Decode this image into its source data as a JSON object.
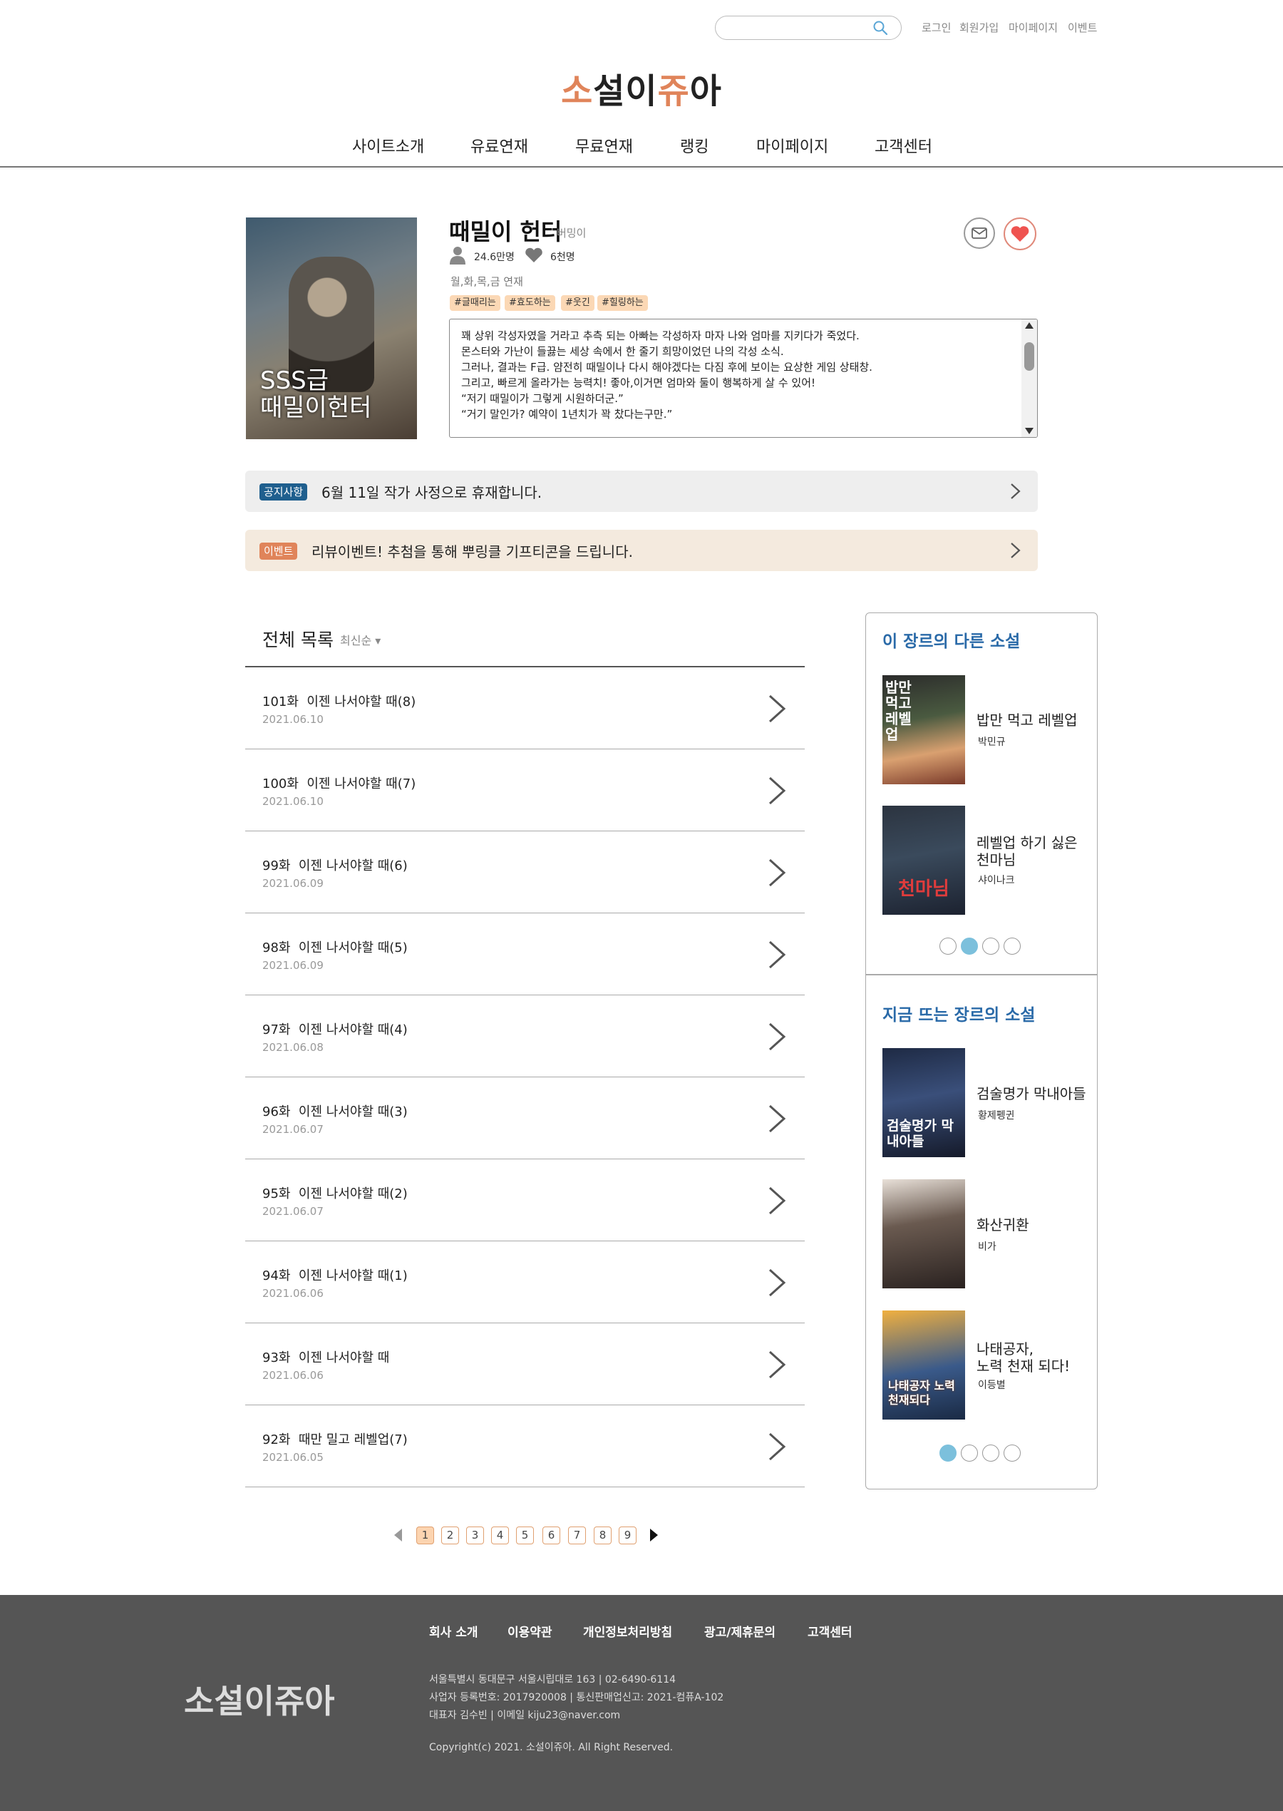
{
  "header": {
    "search_placeholder": "",
    "links": [
      "로그인",
      "회원가입",
      "마이페이지",
      "이벤트"
    ],
    "logo": [
      "소",
      "설",
      "이",
      "쥬",
      "아"
    ],
    "nav": [
      "사이트소개",
      "유료연재",
      "무료연재",
      "랭킹",
      "마이페이지",
      "고객센터"
    ]
  },
  "book": {
    "cover_text_1": "SSS급",
    "cover_text_2": "때밀이헌터",
    "title": "때밀이 헌터",
    "author": "버밍이",
    "views": "24.6만명",
    "likes": "6천명",
    "schedule": "월,화,목,금 연재",
    "tags": [
      "#글때리는",
      "#효도하는",
      "#웃긴",
      "#힐링하는"
    ],
    "synopsis": "꽤 상위 각성자였을 거라고 추측 되는 아빠는 각성하자 마자 나와 엄마를 지키다가 죽었다.\n몬스터와 가난이 들끓는 세상 속에서 한 줄기 희망이었던 나의 각성 소식.\n그러나, 결과는 F급. 얌전히 때밀이나 다시 해야겠다는 다짐 후에 보이는 요상한 게임 상태창.\n그리고, 빠르게 올라가는 능력치! 좋아,이거면 엄마와 둘이 행복하게 살 수 있어!\n“저기 때밀이가 그렇게 시원하더군.”\n“거기 말인가? 예약이 1년치가 꽉 찼다는구만.”"
  },
  "notice": {
    "badge": "공지사항",
    "text": "6월 11일 작가 사정으로 휴재합니다."
  },
  "event": {
    "badge": "이벤트",
    "text": "리뷰이벤트! 추첨을 통해 뿌링클 기프티콘을 드립니다."
  },
  "list": {
    "title": "전체 목록",
    "sort": "최신순 ▾",
    "episodes": [
      {
        "no": "101화",
        "title": "이젠 나서야할 때(8)",
        "date": "2021.06.10"
      },
      {
        "no": "100화",
        "title": "이젠 나서야할 때(7)",
        "date": "2021.06.10"
      },
      {
        "no": "99화",
        "title": "이젠 나서야할 때(6)",
        "date": "2021.06.09"
      },
      {
        "no": "98화",
        "title": "이젠 나서야할 때(5)",
        "date": "2021.06.09"
      },
      {
        "no": "97화",
        "title": "이젠 나서야할 때(4)",
        "date": "2021.06.08"
      },
      {
        "no": "96화",
        "title": "이젠 나서야할 때(3)",
        "date": "2021.06.07"
      },
      {
        "no": "95화",
        "title": "이젠 나서야할 때(2)",
        "date": "2021.06.07"
      },
      {
        "no": "94화",
        "title": "이젠 나서야할 때(1)",
        "date": "2021.06.06"
      },
      {
        "no": "93화",
        "title": "이젠 나서야할 때",
        "date": "2021.06.06"
      },
      {
        "no": "92화",
        "title": "때만 밀고 레벨업(7)",
        "date": "2021.06.05"
      }
    ]
  },
  "pagination": {
    "pages": [
      "1",
      "2",
      "3",
      "4",
      "5",
      "6",
      "7",
      "8",
      "9"
    ],
    "current": "1"
  },
  "sidebar": {
    "section1": {
      "title": "이 장르의 다른 소설",
      "items": [
        {
          "name_1": "밥만 먹고 레벨업",
          "name_2": "",
          "author": "박민규",
          "cover_text": "밥만 먹고 레벨업"
        },
        {
          "name_1": "레벨업 하기 싫은",
          "name_2": "천마님",
          "author": "샤이나크",
          "cover_text": "천마님"
        }
      ],
      "active_dot": 2
    },
    "section2": {
      "title": "지금 뜨는 장르의 소설",
      "items": [
        {
          "name_1": "검술명가 막내아들",
          "name_2": "",
          "author": "황제펭귄",
          "cover_text": "검술명가 막내아들"
        },
        {
          "name_1": "화산귀환",
          "name_2": "",
          "author": "비가",
          "cover_text": ""
        },
        {
          "name_1": "나태공자,",
          "name_2": "노력 천재 되다!",
          "author": "이등별",
          "cover_text": "나태공자 노력천재되다"
        }
      ],
      "active_dot": 1
    }
  },
  "footer": {
    "links": [
      "회사 소개",
      "이용약관",
      "개인정보처리방침",
      "광고/제휴문의",
      "고객센터"
    ],
    "logo": "소설이쥬아",
    "address": "서울특별시 동대문구 서울시립대로 163   |   02-6490-6114",
    "registration": "사업자 등록번호: 2017920008   |   통신판매업신고: 2021-컴퓨A-102",
    "ceo": "대표자 김수빈 | 이메일 kiju23@naver.com",
    "copyright": "Copyright(c) 2021. 소설이쥬아.  All Right Reserved."
  },
  "colors": {
    "accent_orange": "#e0845a",
    "link_blue": "#2a6aa8",
    "tag_bg": "#fbd8b5",
    "footer_bg": "#555555",
    "dot_active": "#7cc0dc"
  }
}
